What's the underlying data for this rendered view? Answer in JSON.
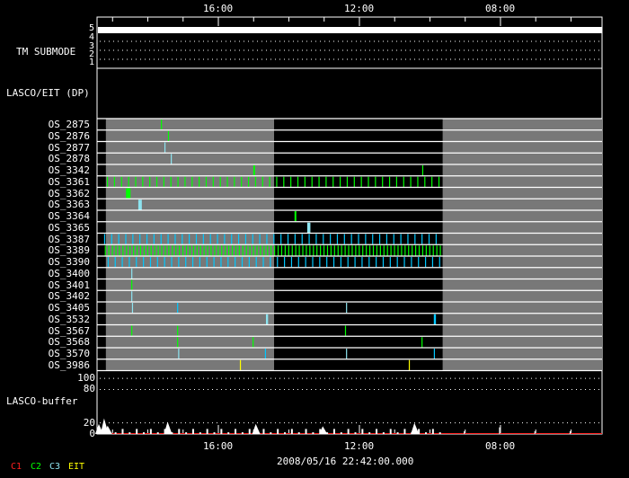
{
  "axis": {
    "top_ticks": [
      {
        "label": "16:00",
        "t": 3.44
      },
      {
        "label": "12:00",
        "t": 7.44
      },
      {
        "label": "08:00",
        "t": 11.44
      }
    ],
    "bottom_ticks": [
      {
        "label": "16:00",
        "t": 3.44
      },
      {
        "label": "12:00",
        "t": 7.44
      },
      {
        "label": "08:00",
        "t": 11.44
      }
    ],
    "span_hours": 14.32,
    "timestamp": "2008/05/16 22:42:00.000"
  },
  "submode": {
    "label": "TM SUBMODE",
    "levels": [
      "5",
      "4",
      "3",
      "2",
      "1"
    ],
    "active_level": 5
  },
  "lasco_eit_label": "LASCO/EIT (DP)",
  "gray_spans": [
    [
      0.25,
      5.02
    ],
    [
      9.8,
      14.32
    ]
  ],
  "colors": {
    "c1": "#ff2020",
    "c2": "#00ff00",
    "c3": "#8de4f0",
    "c3b": "#00c8ff",
    "eit": "#ffff00",
    "gray": "#787878"
  },
  "rows": [
    {
      "name": "OS_2875",
      "marks": [
        {
          "t": 1.81,
          "c": "c2"
        }
      ]
    },
    {
      "name": "OS_2876",
      "marks": [
        {
          "t": 2.01,
          "c": "c2"
        }
      ]
    },
    {
      "name": "OS_2877",
      "marks": [
        {
          "t": 1.91,
          "c": "c3"
        }
      ]
    },
    {
      "name": "OS_2878",
      "marks": [
        {
          "t": 2.09,
          "c": "c3"
        }
      ]
    },
    {
      "name": "OS_3342",
      "marks": [
        {
          "t": 4.43,
          "c": "c2",
          "w": 0.05
        },
        {
          "t": 9.22,
          "c": "c2"
        }
      ]
    },
    {
      "name": "OS_3361",
      "periodic": {
        "start": 0.28,
        "end": 9.75,
        "step": 0.2,
        "c": "c2"
      }
    },
    {
      "name": "OS_3362",
      "marks": [
        {
          "t": 0.82,
          "c": "c2",
          "w": 0.13
        }
      ]
    },
    {
      "name": "OS_3363",
      "marks": [
        {
          "t": 1.17,
          "c": "c3",
          "w": 0.1
        }
      ]
    },
    {
      "name": "OS_3364",
      "marks": [
        {
          "t": 5.6,
          "c": "c2",
          "w": 0.04
        }
      ]
    },
    {
      "name": "OS_3365",
      "marks": [
        {
          "t": 5.96,
          "c": "c3",
          "w": 0.09
        }
      ]
    },
    {
      "name": "OS_3387",
      "periodic": {
        "start": 0.2,
        "end": 9.7,
        "step": 0.2,
        "c": "c3b"
      }
    },
    {
      "name": "OS_3389",
      "periodic": {
        "start": 0.22,
        "end": 9.78,
        "step": 0.1,
        "c": "c2"
      }
    },
    {
      "name": "OS_3390",
      "periodic": {
        "start": 0.3,
        "end": 9.7,
        "step": 0.2,
        "c": "c3b"
      }
    },
    {
      "name": "OS_3400",
      "marks": [
        {
          "t": 0.97,
          "c": "c3"
        }
      ]
    },
    {
      "name": "OS_3401",
      "marks": [
        {
          "t": 0.97,
          "c": "c2"
        }
      ]
    },
    {
      "name": "OS_3402",
      "marks": [
        {
          "t": 0.97,
          "c": "c3"
        }
      ]
    },
    {
      "name": "OS_3405",
      "marks": [
        {
          "t": 0.99,
          "c": "c3"
        },
        {
          "t": 2.27,
          "c": "c3b"
        },
        {
          "t": 7.06,
          "c": "c3"
        }
      ]
    },
    {
      "name": "OS_3532",
      "marks": [
        {
          "t": 4.79,
          "c": "c3",
          "w": 0.06
        },
        {
          "t": 9.55,
          "c": "c3b",
          "w": 0.06
        }
      ]
    },
    {
      "name": "OS_3567",
      "marks": [
        {
          "t": 0.97,
          "c": "c2"
        },
        {
          "t": 2.27,
          "c": "c2"
        },
        {
          "t": 7.03,
          "c": "c2"
        }
      ]
    },
    {
      "name": "OS_3568",
      "marks": [
        {
          "t": 2.27,
          "c": "c2"
        },
        {
          "t": 4.41,
          "c": "c2"
        },
        {
          "t": 9.2,
          "c": "c2"
        }
      ]
    },
    {
      "name": "OS_3570",
      "marks": [
        {
          "t": 2.3,
          "c": "c3"
        },
        {
          "t": 4.76,
          "c": "c3b"
        },
        {
          "t": 7.06,
          "c": "c3"
        },
        {
          "t": 9.55,
          "c": "c3b"
        }
      ]
    },
    {
      "name": "OS_3986",
      "marks": [
        {
          "t": 4.05,
          "c": "eit"
        },
        {
          "t": 8.84,
          "c": "eit"
        }
      ]
    }
  ],
  "buffer": {
    "label": "LASCO-buffer",
    "y_ticks": [
      "100",
      "80",
      "20",
      "0"
    ],
    "y_tick_values": [
      100,
      80,
      20,
      0
    ],
    "dotted_levels": [
      100,
      80,
      20
    ],
    "ymax": 105,
    "peaks": [
      {
        "t": 0.05,
        "v": 18
      },
      {
        "t": 0.2,
        "v": 28
      },
      {
        "t": 0.3,
        "v": 15
      },
      {
        "t": 4.5,
        "v": 18
      },
      {
        "t": 2.0,
        "v": 22
      },
      {
        "t": 6.4,
        "v": 14
      },
      {
        "t": 9.0,
        "v": 20
      }
    ],
    "spike_start": 0.3,
    "spike_end": 9.8,
    "spike_step": 0.4,
    "spike_value": 9,
    "late_spikes": [
      {
        "t": 10.4,
        "v": 5
      },
      {
        "t": 11.4,
        "v": 12
      },
      {
        "t": 12.4,
        "v": 5
      },
      {
        "t": 13.4,
        "v": 5
      }
    ]
  },
  "legend": [
    {
      "label": "C1",
      "c": "c1"
    },
    {
      "label": "C2",
      "c": "c2"
    },
    {
      "label": "C3",
      "c": "c3"
    },
    {
      "label": "EIT",
      "c": "eit"
    }
  ]
}
